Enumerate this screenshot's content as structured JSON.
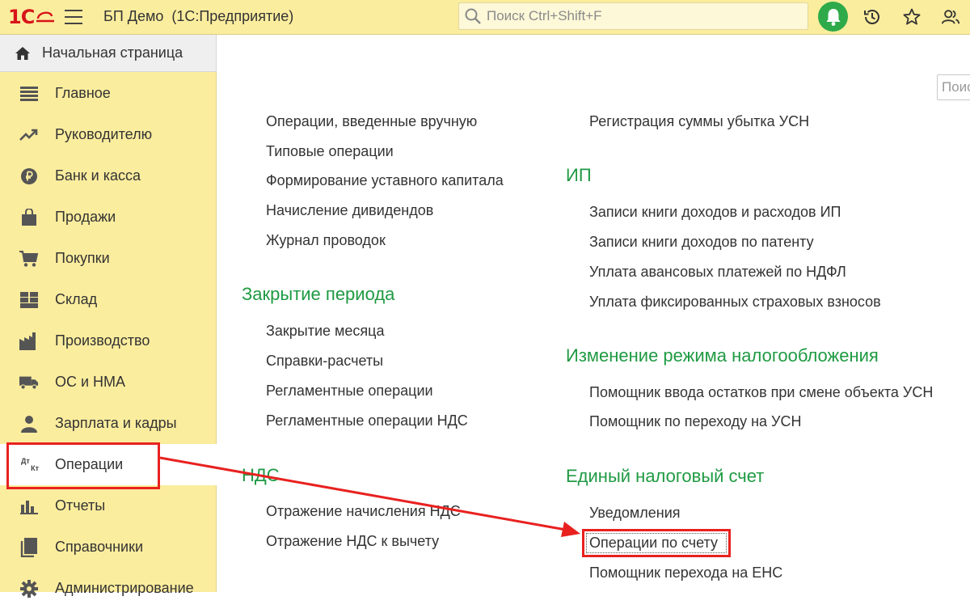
{
  "app": {
    "logo": "1С",
    "title": "БП Демо  (1С:Предприятие)",
    "search_placeholder": "Поиск Ctrl+Shift+F"
  },
  "icons": {
    "menu": "hamburger-icon",
    "notifications": "bell-icon",
    "history": "history-icon",
    "favorites": "star-icon",
    "users": "users-icon"
  },
  "colors": {
    "panel": "#fbed9e",
    "section_heading": "#1f9a43",
    "highlight": "#e8211f",
    "notification": "#2eaa4a"
  },
  "home": {
    "label": "Начальная страница"
  },
  "sidebar": {
    "items": [
      {
        "label": "Главное",
        "icon": "list-icon"
      },
      {
        "label": "Руководителю",
        "icon": "trend-icon"
      },
      {
        "label": "Банк и касса",
        "icon": "ruble-icon"
      },
      {
        "label": "Продажи",
        "icon": "bag-icon"
      },
      {
        "label": "Покупки",
        "icon": "cart-icon"
      },
      {
        "label": "Склад",
        "icon": "warehouse-icon"
      },
      {
        "label": "Производство",
        "icon": "factory-icon"
      },
      {
        "label": "ОС и НМА",
        "icon": "truck-icon"
      },
      {
        "label": "Зарплата и кадры",
        "icon": "person-icon"
      },
      {
        "label": "Операции",
        "icon": "dt-kt-icon",
        "active": true
      },
      {
        "label": "Отчеты",
        "icon": "bar-chart-icon"
      },
      {
        "label": "Справочники",
        "icon": "book-icon"
      },
      {
        "label": "Администрирование",
        "icon": "gear-icon"
      }
    ],
    "dt_kt_icon": {
      "top": "Дт",
      "bottom": "Кт"
    }
  },
  "main": {
    "search_placeholder": "Поис",
    "left_column": {
      "top_links": [
        "Операции, введенные вручную",
        "Типовые операции",
        "Формирование уставного капитала",
        "Начисление дивидендов",
        "Журнал проводок"
      ],
      "closing": {
        "title": "Закрытие периода",
        "links": [
          "Закрытие месяца",
          "Справки-расчеты",
          "Регламентные операции",
          "Регламентные операции НДС"
        ]
      },
      "vat": {
        "title": "НДС",
        "links": [
          "Отражение начисления НДС",
          "Отражение НДС к вычету"
        ]
      }
    },
    "right_column": {
      "top_links": [
        "Регистрация суммы убытка УСН"
      ],
      "ip": {
        "title": "ИП",
        "links": [
          "Записи книги доходов и расходов ИП",
          "Записи книги доходов по патенту",
          "Уплата авансовых платежей по НДФЛ",
          "Уплата фиксированных страховых взносов"
        ]
      },
      "tax_change": {
        "title": "Изменение режима налогообложения",
        "links": [
          "Помощник ввода остатков при смене объекта УСН",
          "Помощник по переходу на УСН"
        ]
      },
      "ens": {
        "title": "Единый налоговый счет",
        "links": [
          "Уведомления",
          "Операции по счету",
          "Помощник перехода на ЕНС"
        ]
      }
    }
  }
}
